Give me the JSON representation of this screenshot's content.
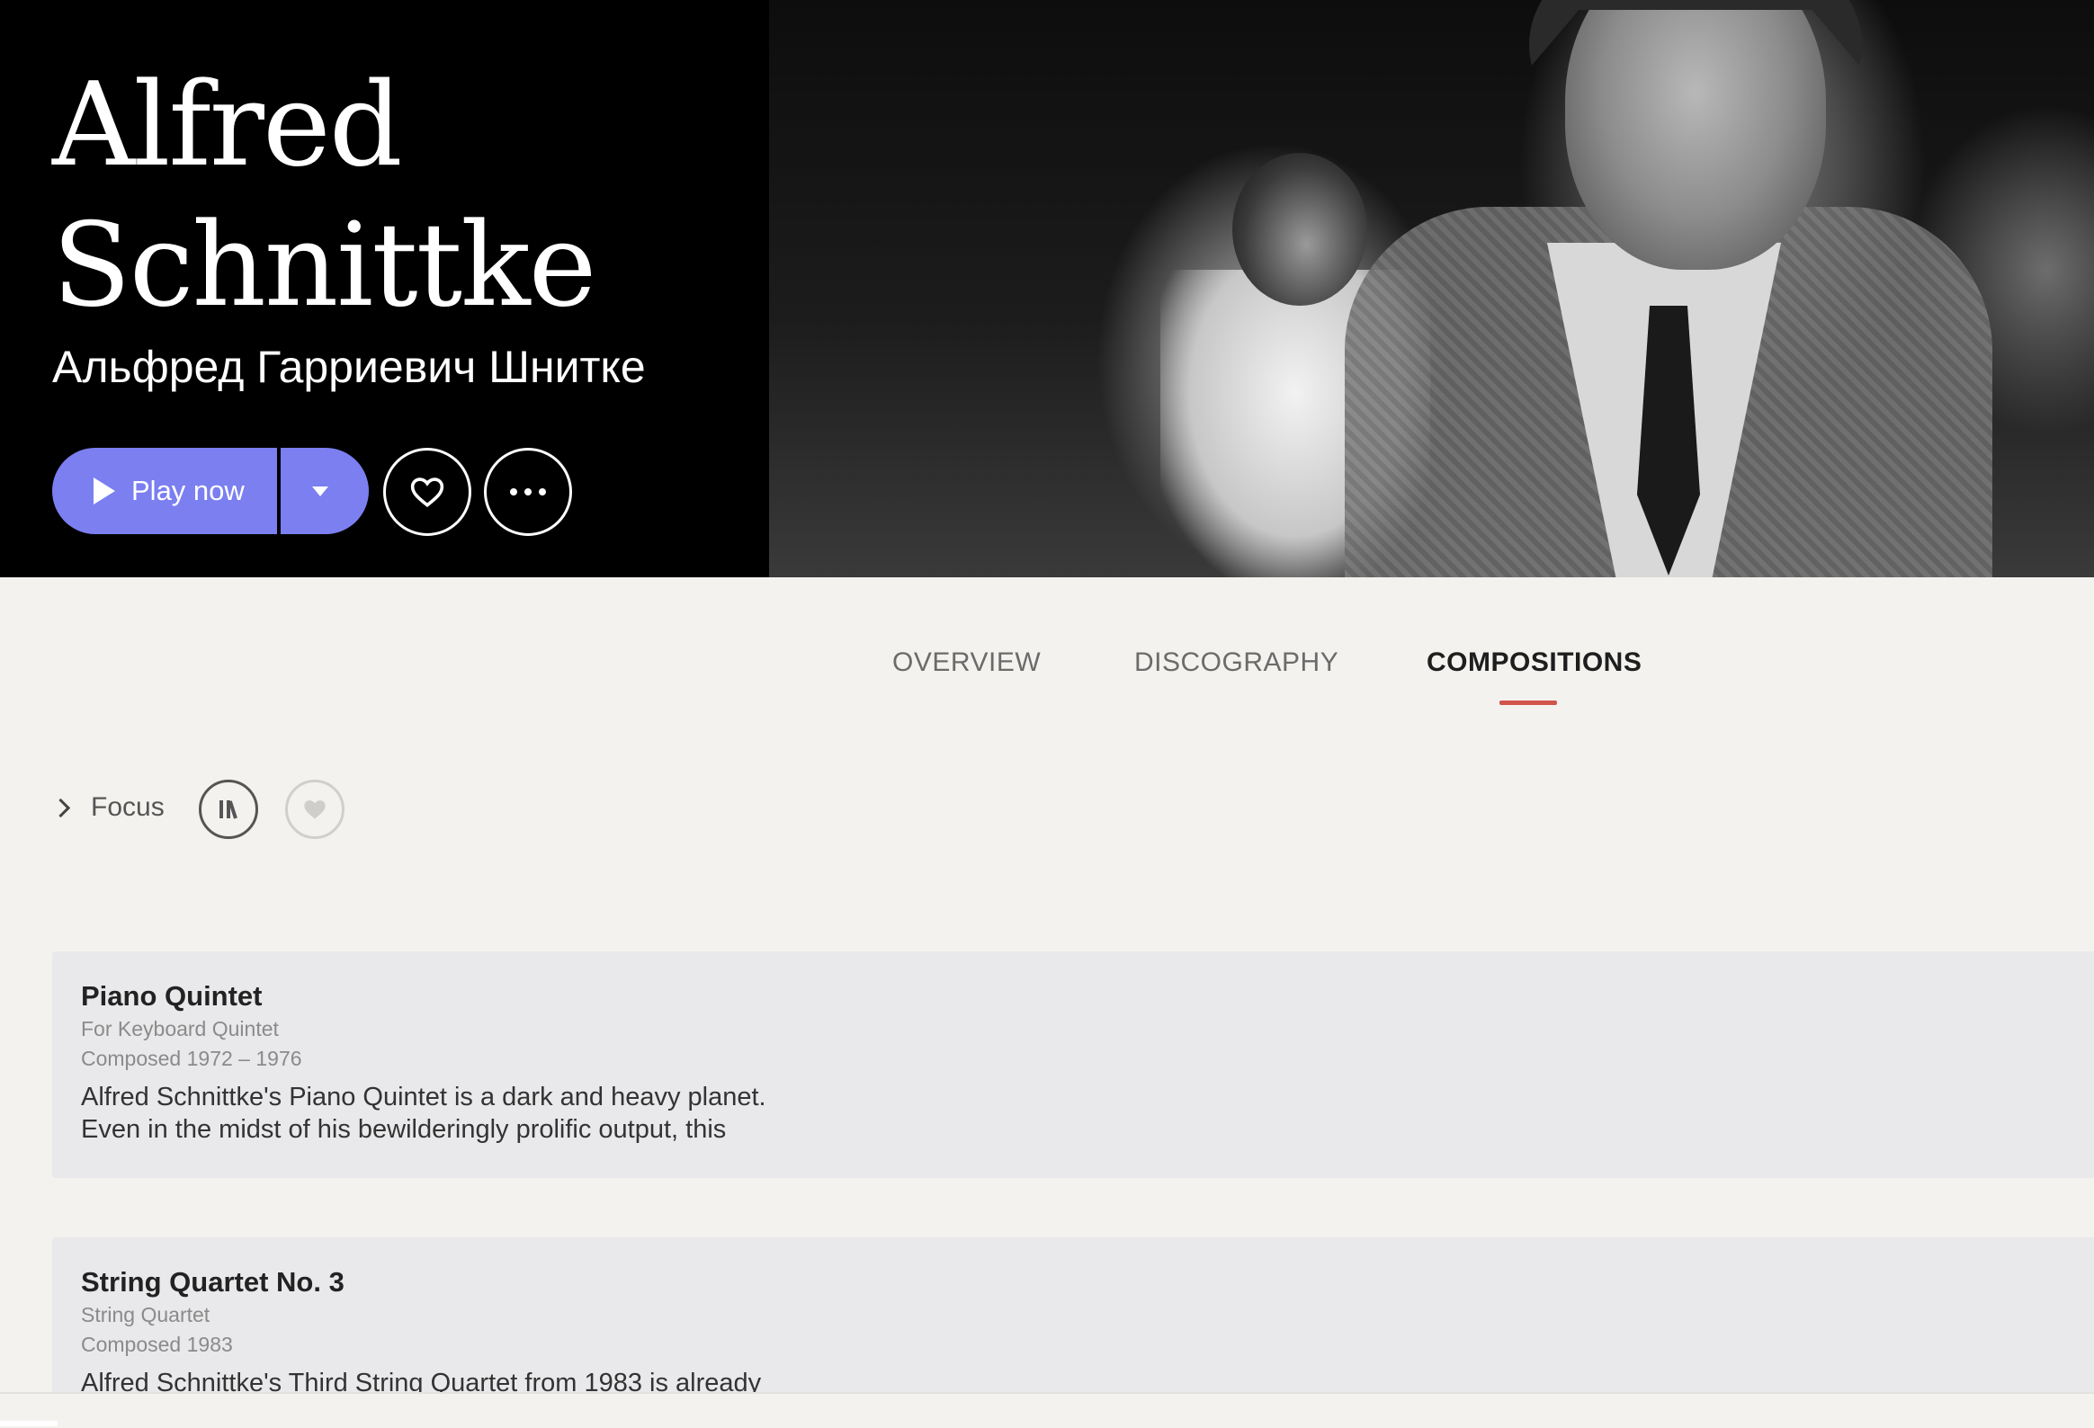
{
  "artist": {
    "name_line1": "Alfred",
    "name_line2": "Schnittke",
    "native_name": "Альфред Гарриевич Шнитке"
  },
  "actions": {
    "play_label": "Play now",
    "play_menu_icon": "caret-down-icon",
    "favorite_icon": "heart-icon",
    "more_icon": "ellipsis-icon"
  },
  "tabs": [
    {
      "label": "OVERVIEW",
      "active": false
    },
    {
      "label": "DISCOGRAPHY",
      "active": false
    },
    {
      "label": "COMPOSITIONS",
      "active": true
    }
  ],
  "filters": {
    "focus_label": "Focus",
    "library_icon": "library-icon",
    "favorite_icon": "heart-filled-icon"
  },
  "compositions": [
    {
      "title": "Piano Quintet",
      "form": "For Keyboard Quintet",
      "composed": "Composed 1972 – 1976",
      "description": "Alfred Schnittke's Piano Quintet is a dark and heavy planet. Even in the midst of his bewilderingly prolific output, this"
    },
    {
      "title": "String Quartet No. 3",
      "form": "String Quartet",
      "composed": "Composed 1983",
      "description": "Alfred Schnittke's Third String Quartet from 1983 is already"
    }
  ],
  "colors": {
    "accent": "#7b7ff0",
    "tab_underline": "#d2554c",
    "background": "#f3f2ef",
    "card_background": "#e9e9eb"
  }
}
